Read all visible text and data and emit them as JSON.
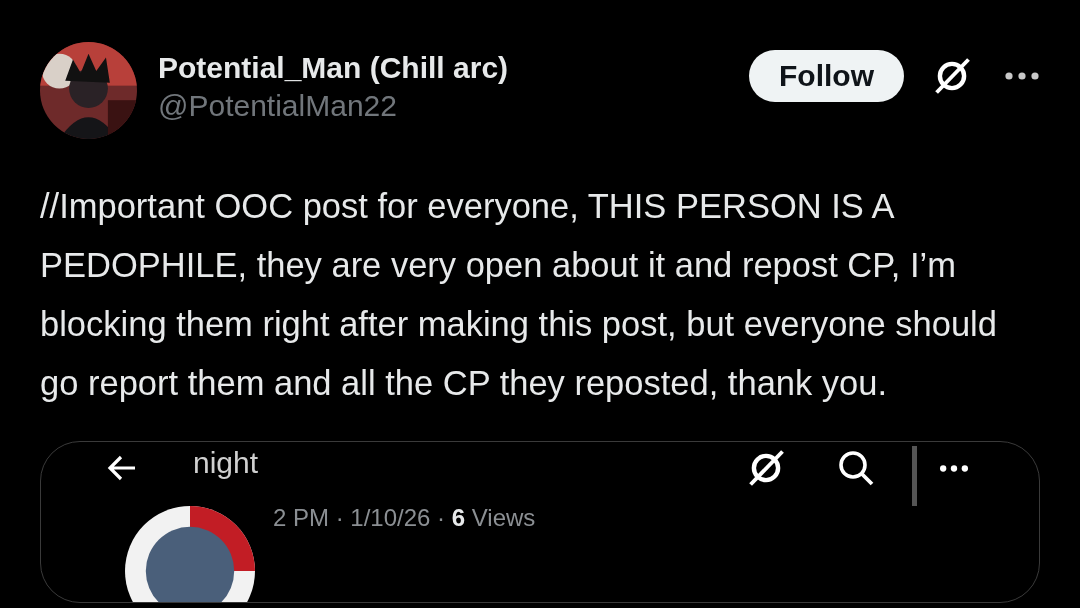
{
  "post": {
    "author": {
      "name": "Potential_Man (Chill arc)",
      "handle": "@PotentialMan22"
    },
    "follow_button": {
      "label": "Follow"
    },
    "text": "//Important OOC post for everyone, THIS PERSON IS A PEDOPHILE, they are very open about it and repost CP, I’m blocking them right after making this post, but everyone should go report them and all the CP they reposted, thank you.",
    "embedded_screenshot": {
      "header_title": "night",
      "meta": "2 PM · 1/10/26 · **6** Views"
    }
  }
}
